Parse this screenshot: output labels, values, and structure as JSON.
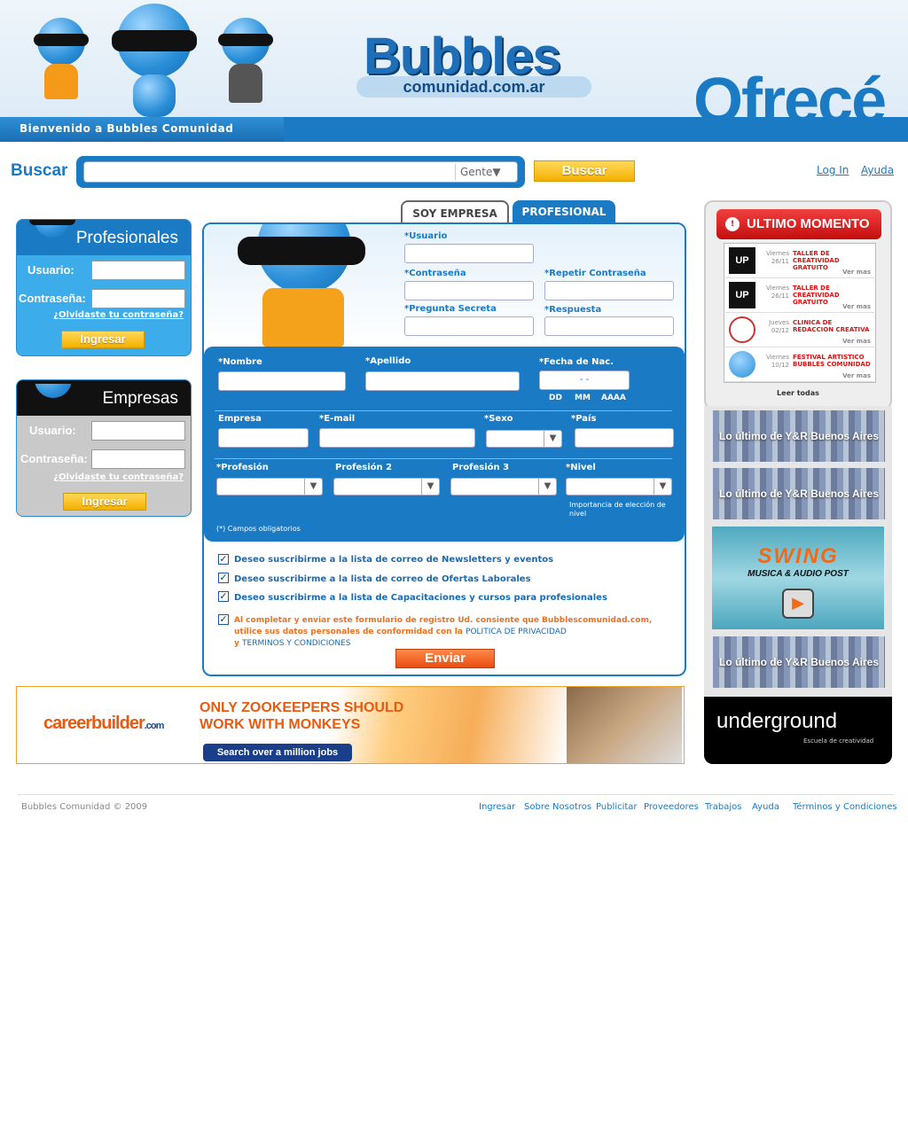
{
  "header": {
    "welcome": "Bienvenido a Bubbles Comunidad",
    "logo_main": "Bubbles",
    "logo_sub": "comunidad.com.ar",
    "tagline_partial": "Ofrecé"
  },
  "search": {
    "label": "Buscar",
    "filter_value": "Gente",
    "button": "Buscar"
  },
  "toplinks": {
    "login": "Log In",
    "help": "Ayuda"
  },
  "profesionales_box": {
    "title": "Profesionales",
    "user_label": "Usuario:",
    "pass_label": "Contraseña:",
    "forgot": "¿Olvidaste tu contraseña?",
    "button": "Ingresar"
  },
  "empresas_box": {
    "title": "Empresas",
    "user_label": "Usuario:",
    "pass_label": "Contraseña:",
    "forgot": "¿Olvidaste tu contraseña?",
    "button": "Ingresar"
  },
  "tabs": {
    "empresa": "SOY EMPRESA",
    "profesional": "PROFESIONAL"
  },
  "form": {
    "usuario": "*Usuario",
    "contrasena": "*Contraseña",
    "repetir": "*Repetir Contraseña",
    "pregunta": "*Pregunta Secreta",
    "respuesta": "*Respuesta",
    "nombre": "*Nombre",
    "apellido": "*Apellido",
    "fecha": "*Fecha de Nac.",
    "fecha_sep": "-          -",
    "dd": "DD",
    "mm": "MM",
    "aaaa": "AAAA",
    "empresa": "Empresa",
    "email": "*E-mail",
    "sexo": "*Sexo",
    "pais": "*País",
    "profesion": "*Profesión",
    "profesion2": "Profesión 2",
    "profesion3": "Profesión 3",
    "nivel": "*Nivel",
    "nivel_note": "Importancia de elección de nivel",
    "obligatorios": "(*) Campos obligatorios",
    "chk1": "Deseo suscribirme a la lista de correo de Newsletters y eventos",
    "chk2": "Deseo suscribirme a la lista de correo de Ofertas Laborales",
    "chk3": "Deseo suscribirme a la lista de Capacitaciones y cursos para profesionales",
    "consent1": "Al completar y enviar este formulario de registro Ud. consiente que Bubblescomunidad.com,",
    "consent2": "utilice sus datos personales de conformidad con la",
    "politica": "POLITICA DE PRIVACIDAD",
    "y": "y",
    "terminos": "TERMINOS Y CONDICIONES",
    "submit": "Enviar"
  },
  "banner": {
    "brand": "careerbuilder",
    "brand_suffix": ".com",
    "line1": "ONLY ZOOKEEPERS SHOULD",
    "line2": "WORK WITH MONKEYS",
    "cta": "Search over a million jobs"
  },
  "ultimo": {
    "title": "ULTIMO MOMENTO",
    "items": [
      {
        "logo": "UP",
        "day": "Viernes",
        "date": "26/11",
        "title": "TALLER DE CREATIVIDAD GRATUITO",
        "more": "Ver mas"
      },
      {
        "logo": "UP",
        "day": "Viernes",
        "date": "26/11",
        "title": "TALLER DE CREATIVIDAD GRATUITO",
        "more": "Ver mas"
      },
      {
        "logo": "",
        "day": "Jueves",
        "date": "02/12",
        "title": "CLINICA DE REDACCION CREATIVA",
        "more": "Ver mas"
      },
      {
        "logo": "",
        "day": "Viernes",
        "date": "10/12",
        "title": "FESTIVAL ARTISTICO BUBBLES COMUNIDAD",
        "more": "Ver mas"
      }
    ],
    "read_all": "Leer todas"
  },
  "promos": {
    "yr": "Lo último de Y&R Buenos Aires",
    "swing1": "SWING",
    "swing2": "MUSICA & AUDIO POST",
    "underground1": "underground",
    "underground2": "Escuela de creatividad"
  },
  "footer": {
    "copyright": "Bubbles Comunidad  © 2009",
    "links": [
      "Ingresar",
      "Sobre Nosotros",
      "Publicitar",
      "Proveedores",
      "Trabajos",
      "Ayuda",
      "Términos y Condiciones"
    ]
  },
  "colors": {
    "primary": "#1a7ac4",
    "accent_yellow": "#f5b000",
    "alert_red": "#c40e0e",
    "orange": "#e84d10"
  }
}
